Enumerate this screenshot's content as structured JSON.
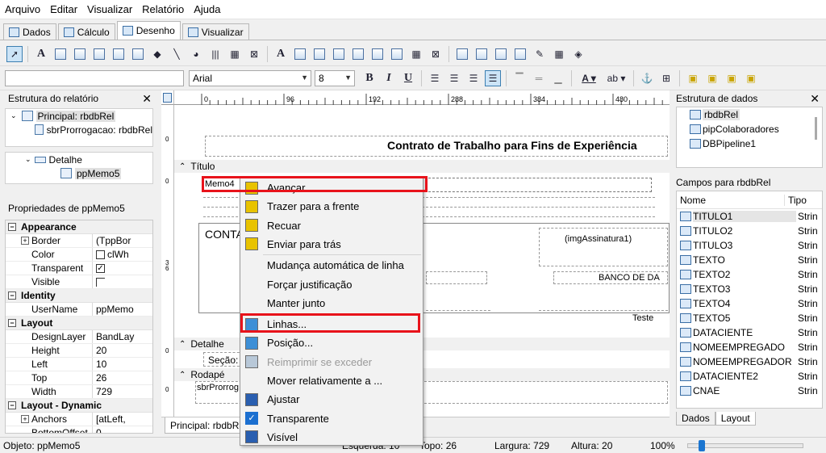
{
  "menu": [
    "Arquivo",
    "Editar",
    "Visualizar",
    "Relatório",
    "Ajuda"
  ],
  "tabs": [
    "Dados",
    "Cálculo",
    "Desenho",
    "Visualizar"
  ],
  "active_tab": "Desenho",
  "format": {
    "font": "Arial",
    "size": "8"
  },
  "report_tree": {
    "title": "Estrutura do relatório",
    "items": [
      "Principal: rbdbRel",
      "sbrProrrogacao: rbdbRel",
      "Detalhe",
      "ppMemo5"
    ]
  },
  "properties": {
    "title": "Propriedades de ppMemo5",
    "groups": [
      {
        "name": "Appearance",
        "rows": [
          {
            "name": "Border",
            "value": "(TppBor",
            "expand": true
          },
          {
            "name": "Color",
            "value": "clWh",
            "swatch": true
          },
          {
            "name": "Transparent",
            "value": "",
            "check": true
          },
          {
            "name": "Visible",
            "value": "",
            "check": false
          }
        ]
      },
      {
        "name": "Identity",
        "rows": [
          {
            "name": "UserName",
            "value": "ppMemo"
          }
        ]
      },
      {
        "name": "Layout",
        "rows": [
          {
            "name": "DesignLayer",
            "value": "BandLay"
          },
          {
            "name": "Height",
            "value": "20"
          },
          {
            "name": "Left",
            "value": "10"
          },
          {
            "name": "Top",
            "value": "26"
          },
          {
            "name": "Width",
            "value": "729"
          }
        ]
      },
      {
        "name": "Layout - Dynamic",
        "rows": [
          {
            "name": "Anchors",
            "value": "[atLeft,",
            "expand": true
          },
          {
            "name": "BottomOffset",
            "value": "0"
          }
        ]
      }
    ]
  },
  "ruler": {
    "marks": [
      "0",
      "96",
      "192",
      "288",
      "384",
      "480"
    ]
  },
  "design": {
    "title_text": "Contrato de Trabalho para Fins de Experiência",
    "band_titulo": "Título",
    "memo": "Memo4",
    "conta": "CONTA",
    "img": "(imgAssinatura1)",
    "banco": "BANCO DE DA",
    "teste": "Teste",
    "band_detalhe": "Detalhe",
    "secao": "Seção:",
    "band_rodape": "Rodapé",
    "sbr": "sbrProrrog",
    "page_tab": "Principal: rbdbR"
  },
  "context_menu": [
    {
      "label": "Avançar",
      "icon": "bring-forward-icon"
    },
    {
      "label": "Trazer para a frente",
      "icon": "bring-front-icon"
    },
    {
      "label": "Recuar",
      "icon": "send-backward-icon"
    },
    {
      "label": "Enviar para trás",
      "icon": "send-back-icon"
    },
    {
      "label": "Mudança automática de linha",
      "icon": ""
    },
    {
      "label": "Forçar justificação",
      "icon": ""
    },
    {
      "label": "Manter junto",
      "icon": ""
    },
    {
      "label": "Linhas...",
      "icon": "lines-icon"
    },
    {
      "label": "Posição...",
      "icon": "position-icon"
    },
    {
      "label": "Reimprimir se exceder",
      "icon": "reprint-icon",
      "disabled": true
    },
    {
      "label": "Mover relativamente a ...",
      "icon": ""
    },
    {
      "label": "Ajustar",
      "icon": "stretch-icon"
    },
    {
      "label": "Transparente",
      "icon": "check-icon"
    },
    {
      "label": "Visível",
      "icon": "visible-icon"
    }
  ],
  "data_tree": {
    "title": "Estrutura de dados",
    "items": [
      "rbdbRel",
      "pipColaboradores",
      "DBPipeline1"
    ]
  },
  "fields": {
    "title": "Campos para rbdbRel",
    "col_name": "Nome",
    "col_type": "Tipo",
    "type_value": "Strin",
    "items": [
      "TITULO1",
      "TITULO2",
      "TITULO3",
      "TEXTO",
      "TEXTO2",
      "TEXTO3",
      "TEXTO4",
      "TEXTO5",
      "DATACIENTE",
      "NOMEEMPREGADO",
      "NOMEEMPREGADOR",
      "DATACIENTE2",
      "CNAE"
    ],
    "tabs": [
      "Dados",
      "Layout"
    ]
  },
  "status": {
    "object": "Objeto: ppMemo5",
    "esquerda": "Esquerda: 10",
    "topo": "Topo: 26",
    "largura": "Largura: 729",
    "altura": "Altura: 20",
    "zoom": "100%"
  },
  "colors": {
    "highlight_red": "#e8131b",
    "selection_blue": "#cce4f7"
  }
}
